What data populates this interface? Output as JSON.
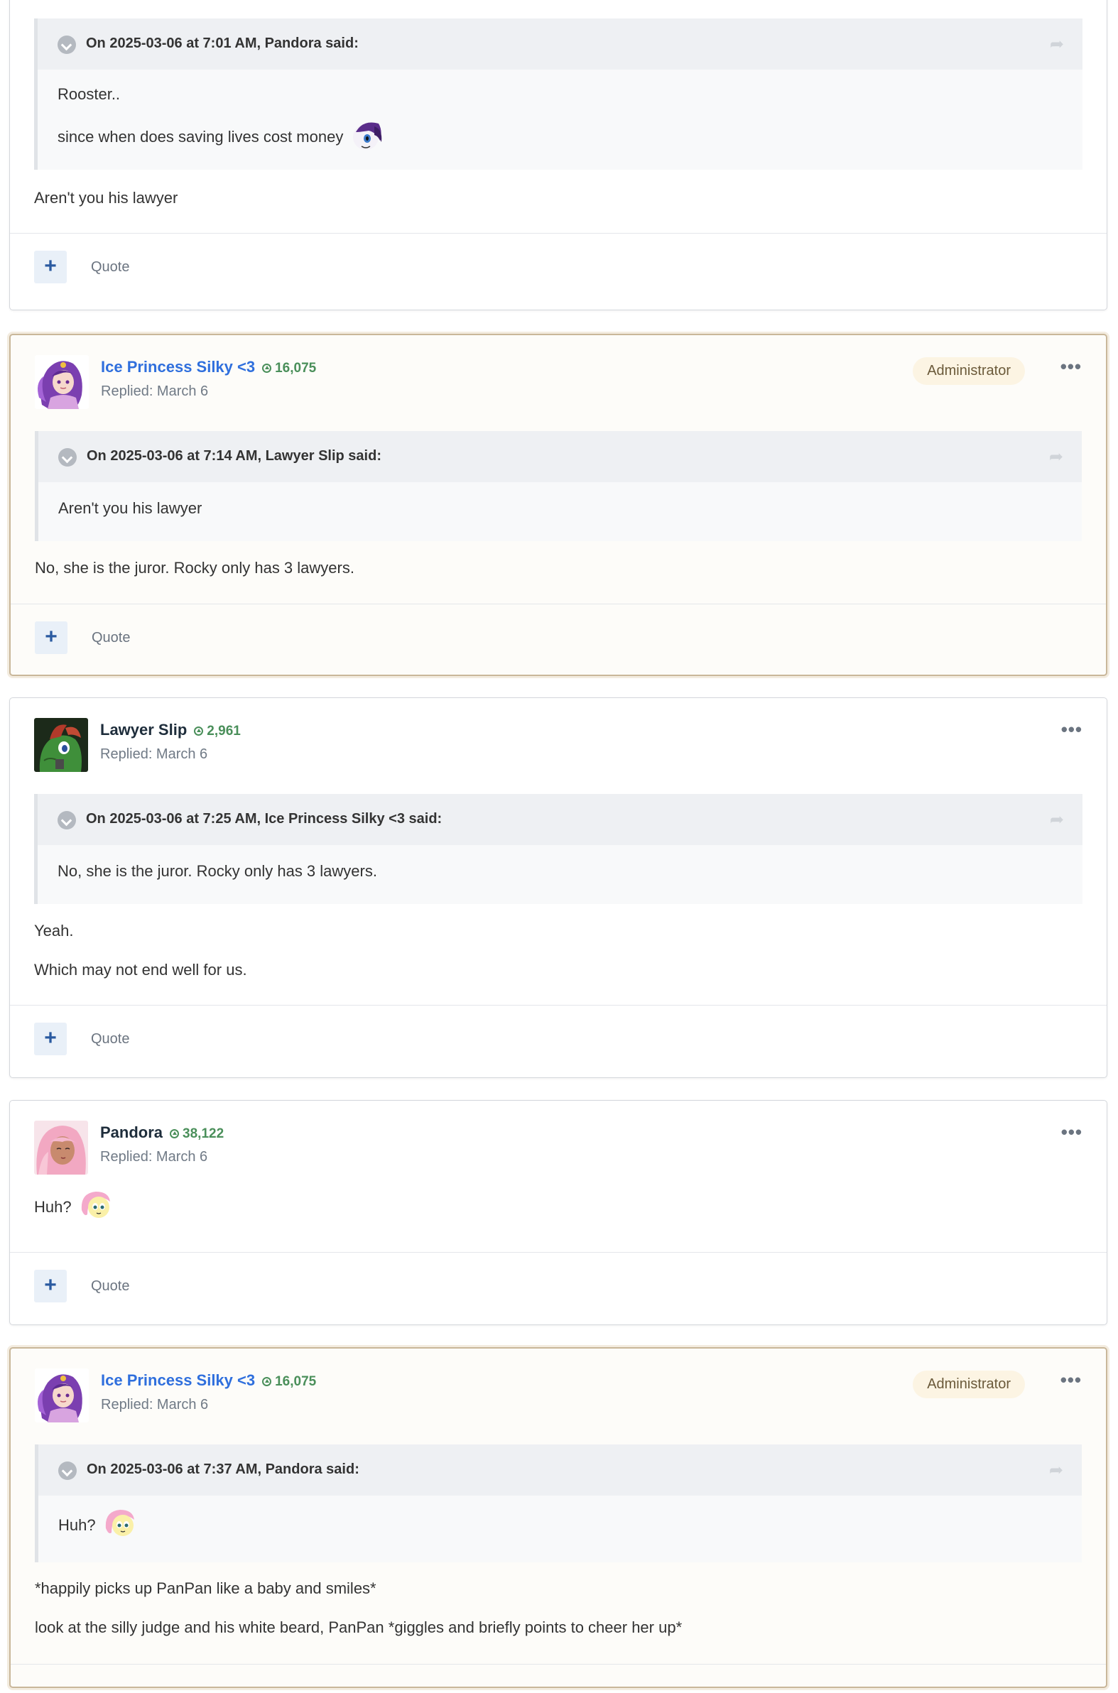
{
  "posts": [
    {
      "quote": {
        "cite": "On 2025-03-06 at 7:01 AM, Pandora said:",
        "lines": [
          "Rooster..",
          "since when does saving lives cost money"
        ]
      },
      "text": [
        "Aren't you his lawyer"
      ],
      "quote_label": "Quote",
      "plus": "+"
    },
    {
      "author": "Ice Princess Silky <3",
      "reputation": "16,075",
      "date": "Replied: March 6",
      "badge": "Administrator",
      "more": "•••",
      "quote": {
        "cite": "On 2025-03-06 at 7:14 AM, Lawyer Slip said:",
        "lines": [
          "Aren't you his lawyer"
        ]
      },
      "text": [
        "No, she is the juror. Rocky only has 3 lawyers."
      ],
      "quote_label": "Quote",
      "plus": "+"
    },
    {
      "author": "Lawyer Slip",
      "reputation": "2,961",
      "date": "Replied: March 6",
      "more": "•••",
      "quote": {
        "cite": "On 2025-03-06 at 7:25 AM, Ice Princess Silky <3 said:",
        "lines": [
          "No, she is the juror. Rocky only has 3 lawyers."
        ]
      },
      "text": [
        "Yeah.",
        "Which may not end well for us."
      ],
      "quote_label": "Quote",
      "plus": "+"
    },
    {
      "author": "Pandora",
      "reputation": "38,122",
      "date": "Replied: March 6",
      "more": "•••",
      "text": [
        "Huh?"
      ],
      "quote_label": "Quote",
      "plus": "+"
    },
    {
      "author": "Ice Princess Silky <3",
      "reputation": "16,075",
      "date": "Replied: March 6",
      "badge": "Administrator",
      "more": "•••",
      "quote": {
        "cite": "On 2025-03-06 at 7:37 AM, Pandora said:",
        "lines": [
          "Huh?"
        ]
      },
      "text": [
        "*happily picks up PanPan like a baby and smiles*",
        "look at the silly judge and his white beard, PanPan *giggles and briefly points to cheer her up*"
      ]
    }
  ],
  "icons": {
    "share": "share-arrow-icon",
    "toggle": "chevron-down-icon",
    "rep": "reputation-icon",
    "emoji_rarity": "rarity-emoji-icon",
    "emoji_fluttershy": "fluttershy-emoji-icon"
  },
  "colors": {
    "staff_name": "#2f6fdd",
    "staff_border": "#c9b79a",
    "reputation": "#4a8f5a",
    "badge_bg": "#fcf4e3"
  }
}
